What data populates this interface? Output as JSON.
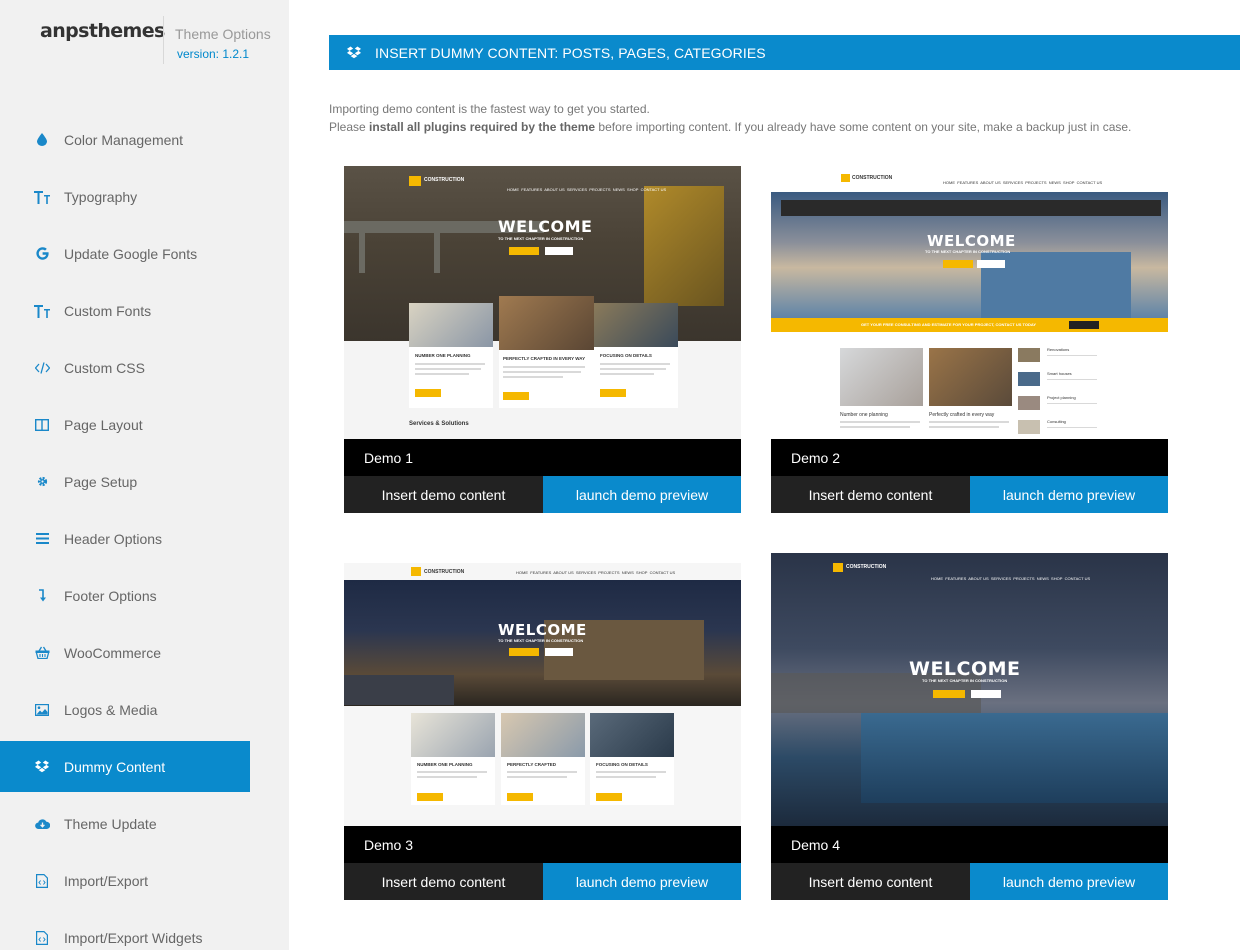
{
  "brand": {
    "logo": "anpsthemes",
    "title": "Theme Options",
    "version": "version: 1.2.1"
  },
  "sidebar": {
    "items": [
      {
        "label": "Color Management",
        "icon": "droplet-icon"
      },
      {
        "label": "Typography",
        "icon": "text-icon"
      },
      {
        "label": "Update Google Fonts",
        "icon": "google-icon"
      },
      {
        "label": "Custom Fonts",
        "icon": "text-icon"
      },
      {
        "label": "Custom CSS",
        "icon": "code-icon"
      },
      {
        "label": "Page Layout",
        "icon": "columns-icon"
      },
      {
        "label": "Page Setup",
        "icon": "gear-icon"
      },
      {
        "label": "Header Options",
        "icon": "menu-icon"
      },
      {
        "label": "Footer Options",
        "icon": "arrow-down-icon"
      },
      {
        "label": "WooCommerce",
        "icon": "basket-icon"
      },
      {
        "label": "Logos & Media",
        "icon": "image-icon"
      },
      {
        "label": "Dummy Content",
        "icon": "dropbox-icon",
        "active": true
      },
      {
        "label": "Theme Update",
        "icon": "cloud-download-icon"
      },
      {
        "label": "Import/Export",
        "icon": "code-file-icon"
      },
      {
        "label": "Import/Export Widgets",
        "icon": "code-file-icon"
      }
    ]
  },
  "main": {
    "header_title": "INSERT DUMMY CONTENT: POSTS, PAGES, CATEGORIES",
    "intro_line1": "Importing demo content is the fastest way to get you started.",
    "intro_line2_pre": "Please ",
    "intro_line2_bold": "install all plugins required by the theme",
    "intro_line2_post": " before importing content. If you already have some content on your site, make a backup just in case."
  },
  "demos": [
    {
      "label": "Demo 1",
      "insert": "Insert demo content",
      "launch": "launch demo preview"
    },
    {
      "label": "Demo 2",
      "insert": "Insert demo content",
      "launch": "launch demo preview"
    },
    {
      "label": "Demo 3",
      "insert": "Insert demo content",
      "launch": "launch demo preview"
    },
    {
      "label": "Demo 4",
      "insert": "Insert demo content",
      "launch": "launch demo preview"
    }
  ],
  "preview_text": {
    "welcome": "WELCOME",
    "subtitle": "TO THE NEXT CHAPTER IN CONSTRUCTION",
    "brand": "CONSTRUCTION",
    "explore": "EXPLORE",
    "buy_now": "BUY NOW",
    "read_more": "READ MORE",
    "nav": [
      "HOME",
      "FEATURES",
      "ABOUT US",
      "SERVICES",
      "PROJECTS",
      "NEWS",
      "SHOP",
      "CONTACT US"
    ],
    "d1_features": [
      "NUMBER ONE PLANNING",
      "PERFECTLY CRAFTED IN EVERY WAY",
      "FOCUSING ON DETAILS"
    ],
    "d1_services": "Services & Solutions",
    "d2_banner": "GET YOUR FREE CONSULTING AND ESTIMATE FOR YOUR PROJECT, CONTACT US TODAY",
    "d2_banner_btn": "GET A QUOTE",
    "d2_features": [
      "Number one planning",
      "Perfectly crafted in every way"
    ],
    "d2_side": [
      "Renovations",
      "Smart houses",
      "Project planning",
      "Consulting"
    ],
    "d3_features": [
      "NUMBER ONE PLANNING",
      "PERFECTLY CRAFTED",
      "FOCUSING ON DETAILS"
    ]
  }
}
